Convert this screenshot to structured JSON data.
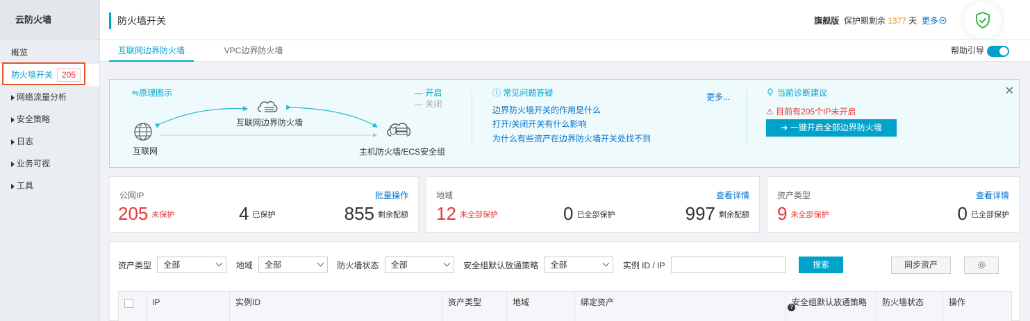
{
  "sidebar": {
    "brand": "云防火墙",
    "items": [
      {
        "label": "概览"
      },
      {
        "label": "防火墙开关",
        "badge": "205",
        "active": true
      },
      {
        "label": "网络流量分析"
      },
      {
        "label": "安全策略"
      },
      {
        "label": "日志"
      },
      {
        "label": "业务可视"
      },
      {
        "label": "工具"
      }
    ]
  },
  "header": {
    "title": "防火墙开关",
    "edition": "旗舰版",
    "protect_prefix": "保护期剩余",
    "days": "1377",
    "days_unit": "天",
    "more": "更多"
  },
  "tabs": [
    {
      "label": "互联网边界防火墙",
      "active": true
    },
    {
      "label": "VPC边界防火墙",
      "active": false
    }
  ],
  "help_guide": "帮助引导",
  "info": {
    "diagram_title": "原理图示",
    "legend_on": "— 开启",
    "legend_off": "— 关闭",
    "node_internet": "互联网",
    "node_firewall": "互联网边界防火墙",
    "node_host": "主机防火墙/ECS安全组",
    "faq_title": "常见问题答疑",
    "faq_more": "更多...",
    "faq": [
      "边界防火墙开关的作用是什么",
      "打开/关闭开关有什么影响",
      "为什么有些资产在边界防火墙开关处找不到"
    ],
    "diag_title": "当前诊断建议",
    "diag_warning": "目前有205个IP未开启",
    "diag_button": "一键开启全部边界防火墙"
  },
  "cards": {
    "ip": {
      "label": "公网IP",
      "action": "批量操作",
      "unprotected": "205",
      "unprotected_label": "未保护",
      "protected": "4",
      "protected_label": "已保护",
      "remaining": "855",
      "remaining_label": "剩余配额"
    },
    "region": {
      "label": "地域",
      "action": "查看详情",
      "unprotected": "12",
      "unprotected_label": "未全部保护",
      "protected": "0",
      "protected_label": "已全部保护",
      "remaining": "997",
      "remaining_label": "剩余配额"
    },
    "asset": {
      "label": "资产类型",
      "action": "查看详情",
      "unprotected": "9",
      "unprotected_label": "未全部保护",
      "protected": "0",
      "protected_label": "已全部保护"
    }
  },
  "filters": {
    "asset_type_label": "资产类型",
    "asset_type_value": "全部",
    "region_label": "地域",
    "region_value": "全部",
    "fw_status_label": "防火墙状态",
    "fw_status_value": "全部",
    "sg_policy_label": "安全组默认放通策略",
    "sg_policy_value": "全部",
    "instance_label": "实例 ID / IP",
    "instance_value": "",
    "search_button": "搜索",
    "sync_button": "同步资产"
  },
  "table": {
    "columns": [
      "IP",
      "实例ID",
      "资产类型",
      "地域",
      "绑定资产",
      "安全组默认放通策略",
      "防火墙状态",
      "操作"
    ]
  },
  "colors": {
    "accent": "#00a2ca",
    "link": "#0070cc",
    "danger": "#e4393c",
    "warning": "#ff8a00"
  }
}
